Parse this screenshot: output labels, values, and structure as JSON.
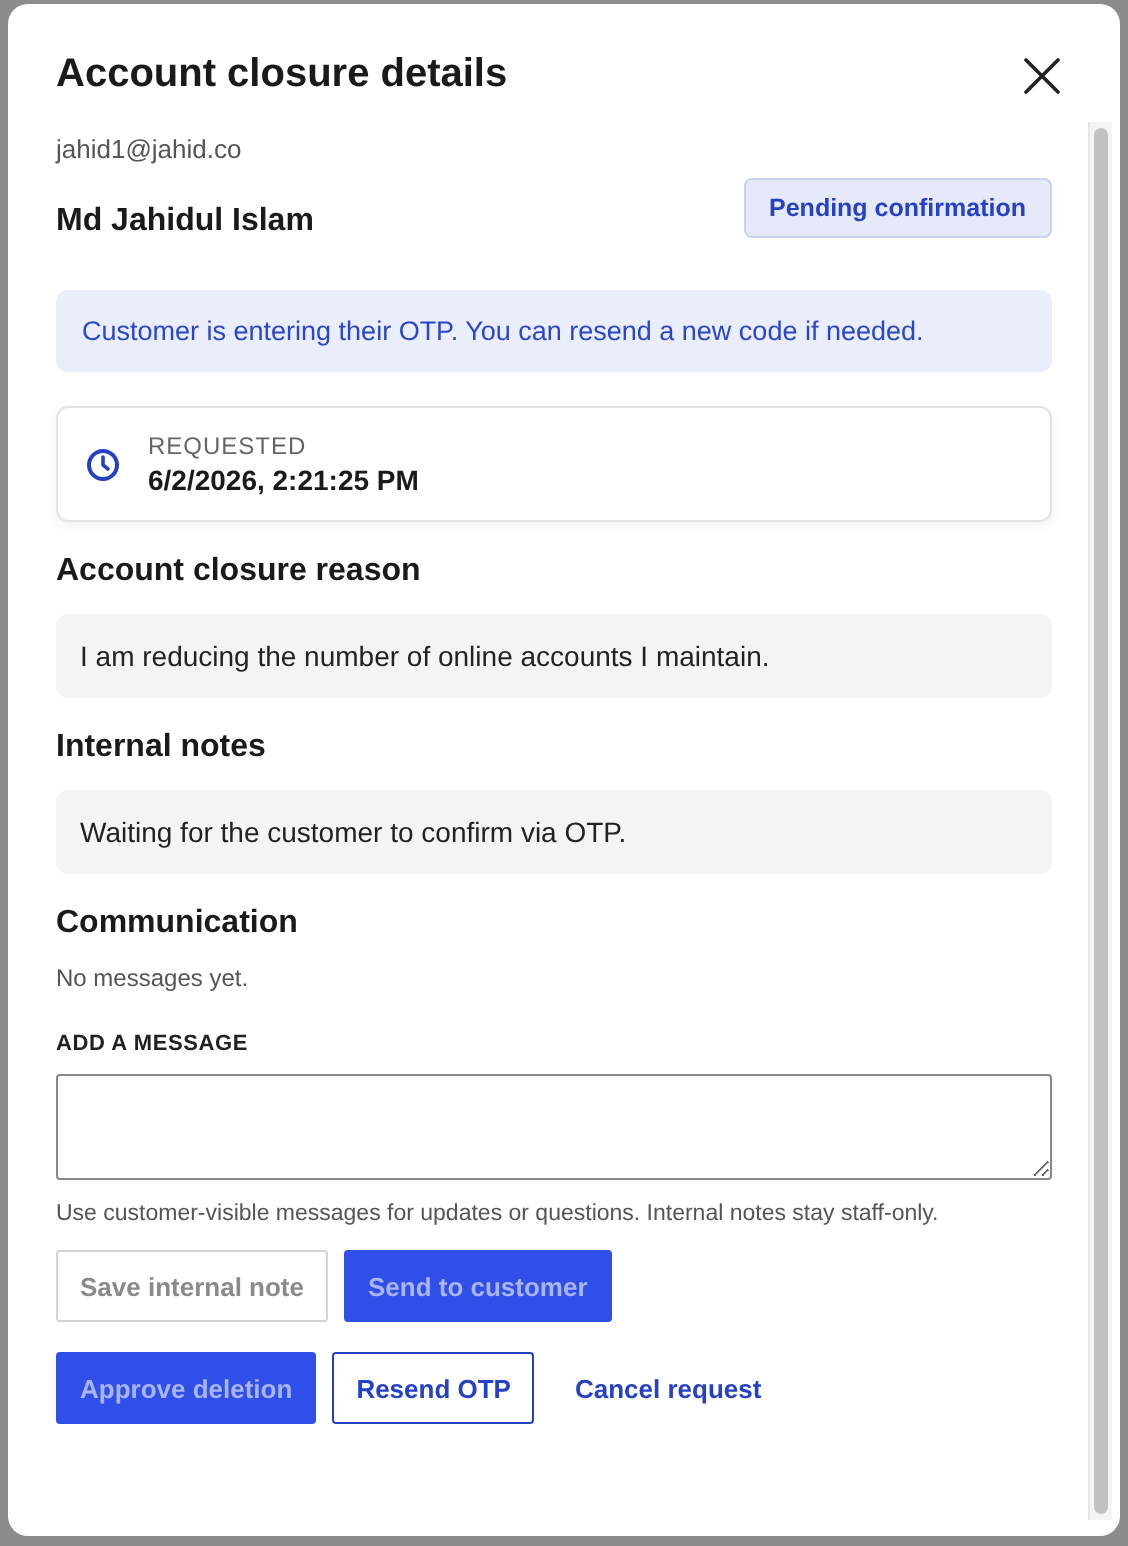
{
  "dialog": {
    "title": "Account closure details"
  },
  "customer": {
    "email": "jahid1@jahid.co",
    "name": "Md Jahidul Islam",
    "status": "Pending confirmation"
  },
  "notice": "Customer is entering their OTP. You can resend a new code if needed.",
  "requested": {
    "label": "REQUESTED",
    "value": "6/2/2026, 2:21:25 PM"
  },
  "sections": [
    {
      "heading": "Account closure reason",
      "text": "I am reducing the number of online accounts I maintain."
    },
    {
      "heading": "Internal notes",
      "text": "Waiting for the customer to confirm via OTP."
    }
  ],
  "communication": {
    "heading": "Communication",
    "empty_text": "No messages yet.",
    "field_label": "ADD A MESSAGE",
    "hint": "Use customer-visible messages for updates or questions. Internal notes stay staff-only."
  },
  "message_buttons": [
    {
      "label": "Save internal note",
      "kind": "secondary",
      "disabled": true
    },
    {
      "label": "Send to customer",
      "kind": "primary",
      "disabled": true
    }
  ],
  "action_buttons": [
    {
      "label": "Approve deletion",
      "kind": "primary",
      "disabled": true
    },
    {
      "label": "Resend OTP",
      "kind": "outline",
      "disabled": false
    },
    {
      "label": "Cancel request",
      "kind": "link",
      "disabled": false
    }
  ]
}
